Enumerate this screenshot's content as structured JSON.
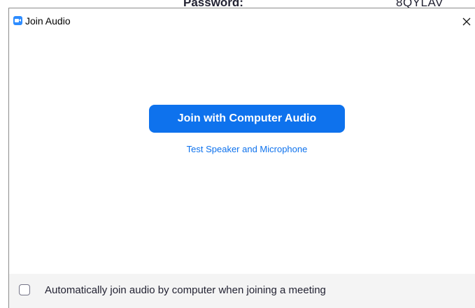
{
  "background_window": {
    "field_label": "Password:",
    "field_value": "8QYLAV"
  },
  "dialog": {
    "title": "Join Audio",
    "app_icon": "zoom-camera-icon",
    "close_icon": "close-icon",
    "primary_button_label": "Join with Computer Audio",
    "secondary_link_label": "Test Speaker and Microphone",
    "auto_join_checkbox": {
      "label": "Automatically join audio by computer when joining a meeting",
      "checked": false
    }
  },
  "colors": {
    "accent": "#0e72ed",
    "app_icon": "#2d8cff",
    "footer_bg": "#f4f4f4"
  }
}
